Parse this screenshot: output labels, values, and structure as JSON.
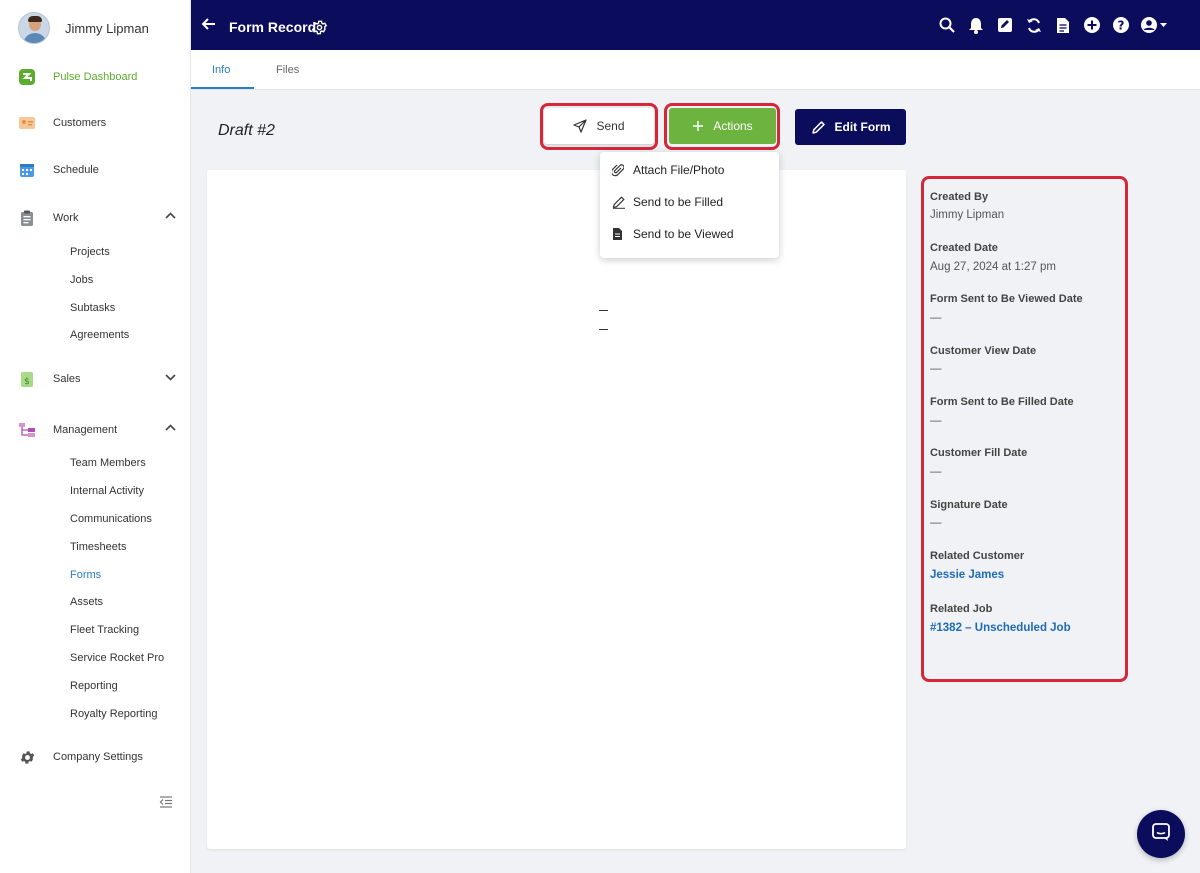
{
  "user": {
    "name": "Jimmy Lipman"
  },
  "sidebar": {
    "pulse": "Pulse Dashboard",
    "customers": "Customers",
    "schedule": "Schedule",
    "work": "Work",
    "work_items": [
      "Projects",
      "Jobs",
      "Subtasks",
      "Agreements"
    ],
    "sales": "Sales",
    "management": "Management",
    "management_items": [
      "Team Members",
      "Internal Activity",
      "Communications",
      "Timesheets",
      "Forms",
      "Assets",
      "Fleet Tracking",
      "Service Rocket Pro",
      "Reporting",
      "Royalty Reporting"
    ],
    "company_settings": "Company Settings"
  },
  "header": {
    "title": "Form Record"
  },
  "tabs": [
    {
      "label": "Info"
    },
    {
      "label": "Files"
    }
  ],
  "page": {
    "title": "Draft #2"
  },
  "buttons": {
    "send": "Send",
    "actions": "Actions",
    "edit": "Edit Form"
  },
  "dropdown": {
    "items": [
      "Attach File/Photo",
      "Send to be Filled",
      "Send to be Viewed"
    ]
  },
  "info": {
    "created_by_label": "Created By",
    "created_by": "Jimmy Lipman",
    "created_date_label": "Created Date",
    "created_date": "Aug 27, 2024 at 1:27 pm",
    "sent_viewed_label": "Form Sent to Be Viewed Date",
    "sent_viewed": "—",
    "customer_view_label": "Customer View Date",
    "customer_view": "—",
    "sent_filled_label": "Form Sent to Be Filled Date",
    "sent_filled": "—",
    "customer_fill_label": "Customer Fill Date",
    "customer_fill": "—",
    "signature_label": "Signature Date",
    "signature": "—",
    "related_customer_label": "Related Customer",
    "related_customer": "Jessie James",
    "related_job_label": "Related Job",
    "related_job": "#1382 – Unscheduled Job"
  },
  "colors": {
    "nav_bg": "#0b0d5c",
    "accent_green": "#6cb33f",
    "link_blue": "#1e6bb8",
    "highlight_red": "#d6263a"
  }
}
